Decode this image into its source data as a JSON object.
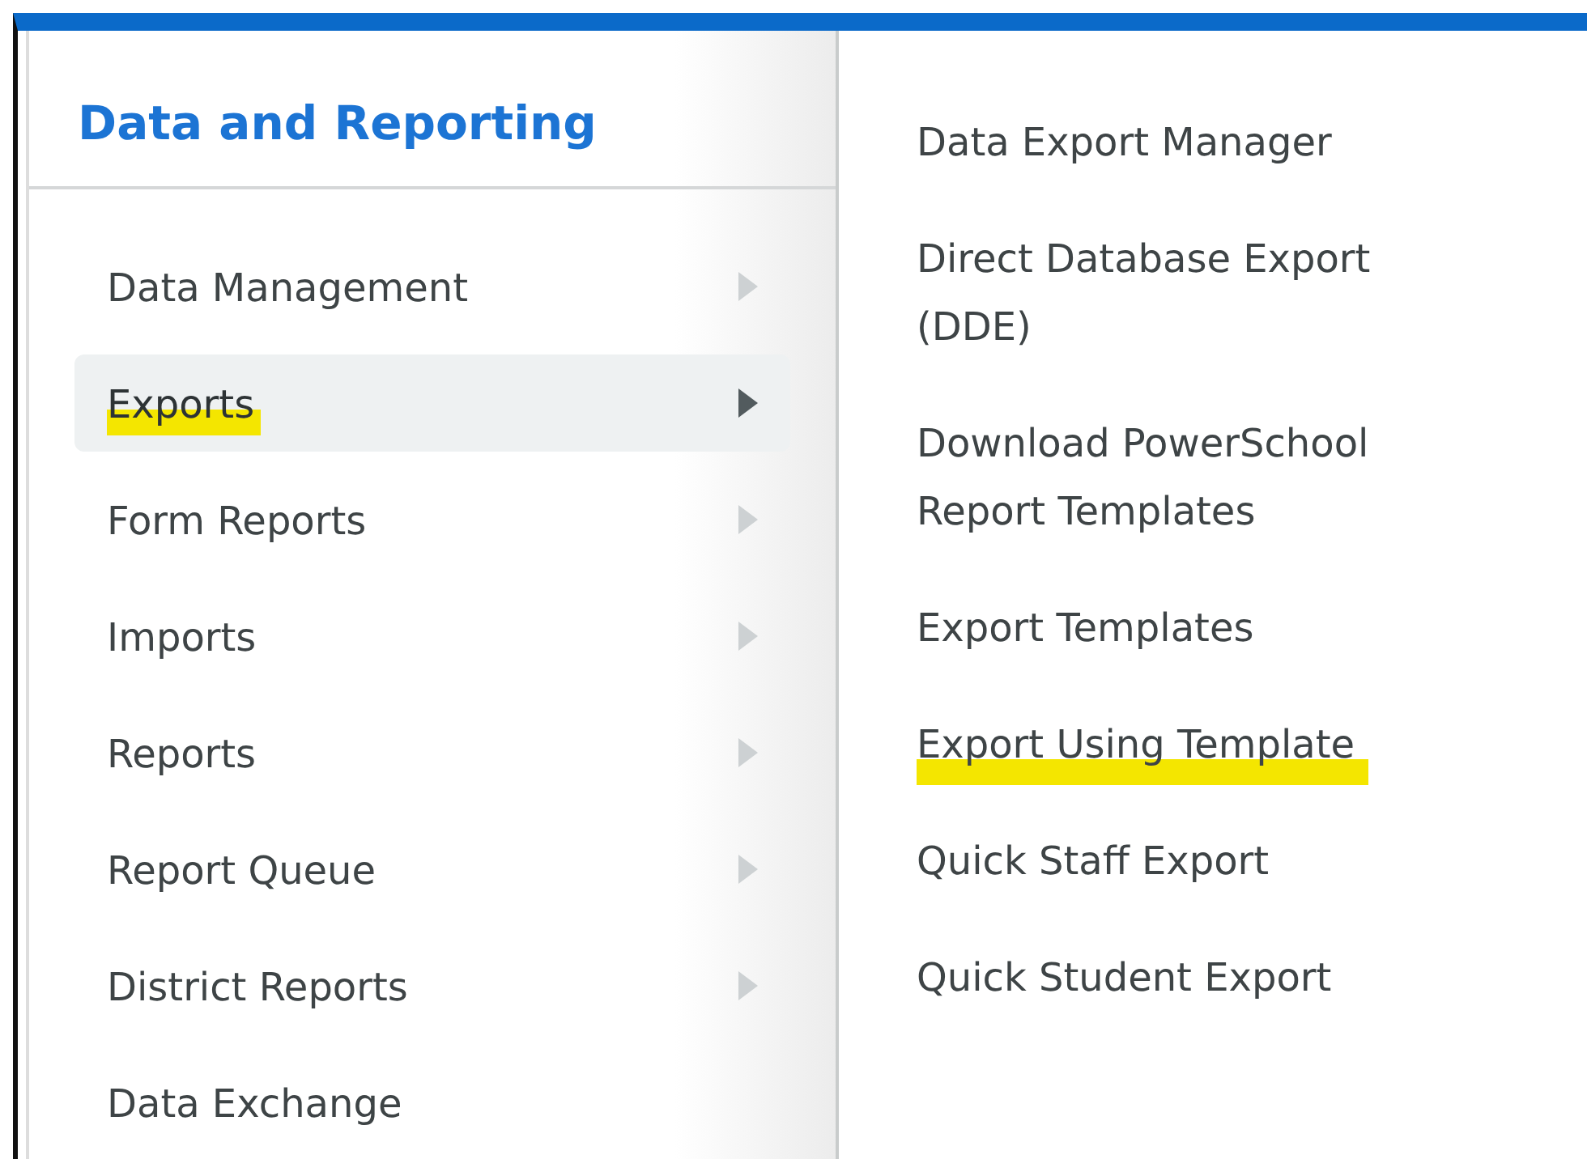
{
  "menu": {
    "title": "Data and Reporting",
    "items": [
      {
        "label": "Data Management",
        "selected": false,
        "has_submenu": true,
        "highlighted": false
      },
      {
        "label": "Exports",
        "selected": true,
        "has_submenu": true,
        "highlighted": true
      },
      {
        "label": "Form Reports",
        "selected": false,
        "has_submenu": true,
        "highlighted": false
      },
      {
        "label": "Imports",
        "selected": false,
        "has_submenu": true,
        "highlighted": false
      },
      {
        "label": "Reports",
        "selected": false,
        "has_submenu": true,
        "highlighted": false
      },
      {
        "label": "Report Queue",
        "selected": false,
        "has_submenu": true,
        "highlighted": false
      },
      {
        "label": "District Reports",
        "selected": false,
        "has_submenu": true,
        "highlighted": false
      },
      {
        "label": "Data Exchange",
        "selected": false,
        "has_submenu": false,
        "highlighted": false
      }
    ]
  },
  "submenu": {
    "items": [
      {
        "label": "Data Export Manager",
        "highlighted": false
      },
      {
        "label": "Direct Database Export (DDE)",
        "highlighted": false
      },
      {
        "label": "Download PowerSchool Report Templates",
        "highlighted": false
      },
      {
        "label": "Export Templates",
        "highlighted": false
      },
      {
        "label": "Export Using Template",
        "highlighted": true
      },
      {
        "label": "Quick Staff Export",
        "highlighted": false
      },
      {
        "label": "Quick Student Export",
        "highlighted": false
      }
    ]
  }
}
